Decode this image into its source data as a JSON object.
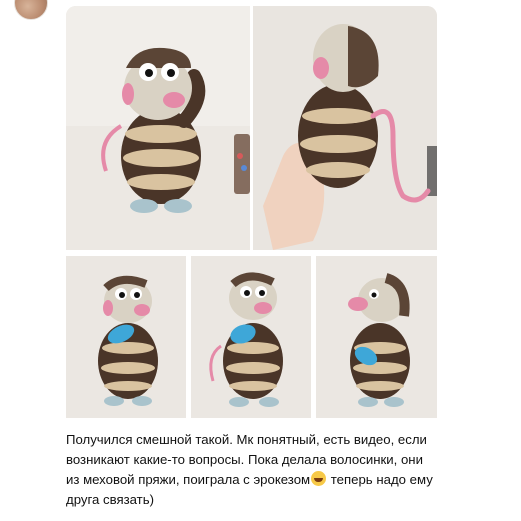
{
  "message": {
    "sender_avatar": "avatar",
    "photos": [
      {
        "name": "photo-front",
        "bg": "#ece8e3"
      },
      {
        "name": "photo-back-hand",
        "bg": "#e9e5e0"
      },
      {
        "name": "photo-with-toy-left",
        "bg": "#ebe7e2"
      },
      {
        "name": "photo-with-toy-center",
        "bg": "#ebe7e2"
      },
      {
        "name": "photo-with-toy-side",
        "bg": "#ebe7e2"
      }
    ],
    "text_part1": "Получился смешной такой. Мк понятный, есть видео, если возникают какие-то вопросы. Пока делала волосинки, они из меховой пряжи, поиграла с эрокезом",
    "emoji": "grinning-face-emoji",
    "text_part2": " теперь надо ему друга связать)"
  },
  "colors": {
    "fur": "#4a3528",
    "stripe": "#d9c3a0",
    "head": "#d9d2c4",
    "nose": "#e58aa8",
    "feet": "#a9c3cc",
    "toy": "#3ea7d8",
    "skin": "#f0d2bf"
  }
}
